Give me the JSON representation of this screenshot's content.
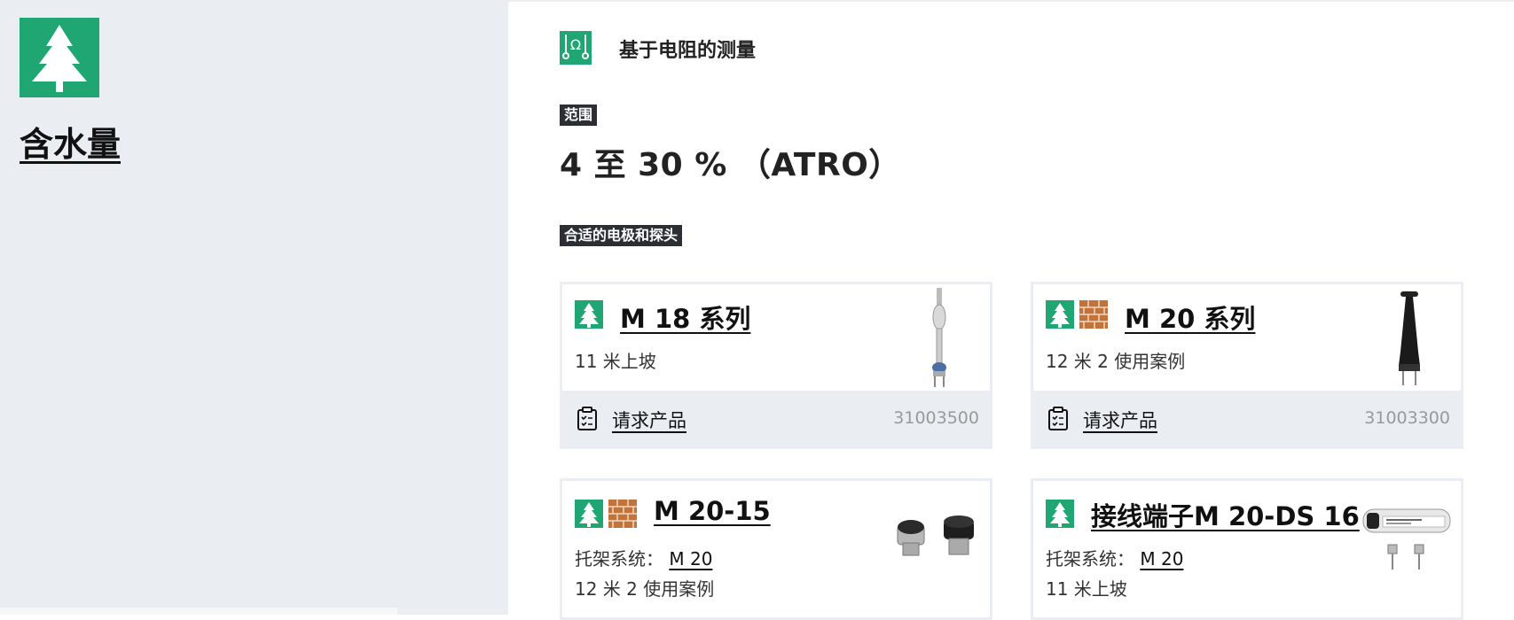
{
  "category": {
    "title": "含水量",
    "icon": "tree-icon",
    "color": "#1fa672"
  },
  "method": {
    "icon": "resistance-ohm-icon",
    "title": "基于电阻的测量"
  },
  "range": {
    "tag": "范围",
    "value": "4 至 30 % （ATRO）"
  },
  "electrodes": {
    "tag": "合适的电极和探头",
    "cards": [
      {
        "title": "M 18 系列",
        "icons": [
          "tree-icon"
        ],
        "line1": "11 米上坡",
        "request_label": "请求产品",
        "part_no": "31003500",
        "image": "m18-electrode-image"
      },
      {
        "title": "M 20 系列",
        "icons": [
          "tree-icon",
          "brick-icon"
        ],
        "line1": "12 米  2 使用案例",
        "request_label": "请求产品",
        "part_no": "31003300",
        "image": "m20-electrode-image"
      },
      {
        "title": "M 20-15",
        "icons": [
          "tree-icon",
          "brick-icon"
        ],
        "holder_label": "托架系统：",
        "holder_link": "M 20",
        "line2": "12 米  2 使用案例",
        "image": "m20-15-caps-image"
      },
      {
        "title": "接线端子M 20-DS 16",
        "icons": [
          "tree-icon"
        ],
        "holder_label": "托架系统：",
        "holder_link": "M 20",
        "line2": "11 米上坡",
        "image": "m20-ds16-terminals-image"
      }
    ]
  },
  "colors": {
    "accent_green": "#1fa672",
    "brick": "#c0733b",
    "panel_bg": "#eaeef3",
    "tag_bg": "#2b2f33"
  }
}
